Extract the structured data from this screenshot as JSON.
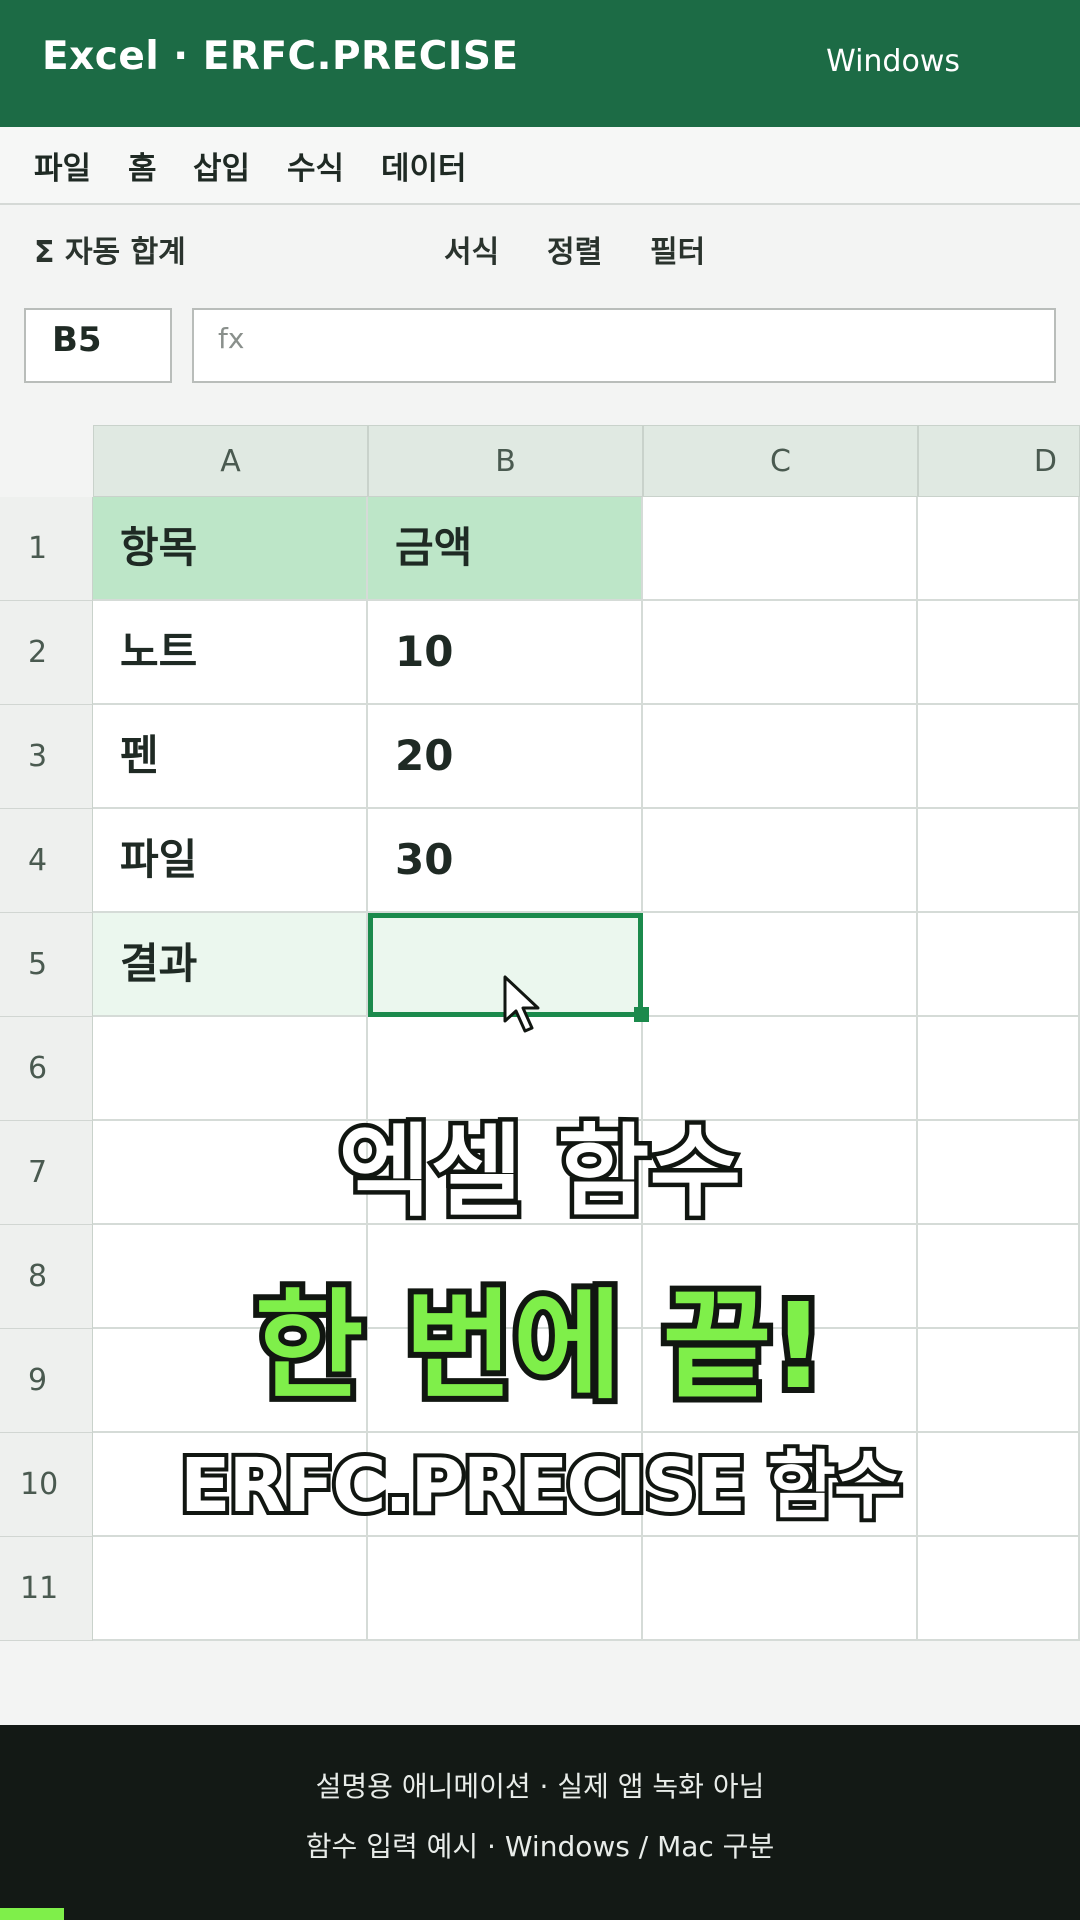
{
  "titlebar": {
    "title": "Excel · ERFC.PRECISE",
    "platform": "Windows"
  },
  "menu": {
    "items": [
      "파일",
      "홈",
      "삽입",
      "수식",
      "데이터"
    ]
  },
  "ribbon": {
    "autosum": "Σ 자동 합계",
    "format": "서식",
    "sort": "정렬",
    "filter": "필터"
  },
  "formula_bar": {
    "name_box": "B5",
    "fx_label": "fx",
    "value": ""
  },
  "sheet": {
    "columns": [
      "A",
      "B",
      "C",
      "D"
    ],
    "rows": [
      "1",
      "2",
      "3",
      "4",
      "5",
      "6",
      "7",
      "8",
      "9",
      "10",
      "11"
    ],
    "cells": {
      "a1": "항목",
      "b1": "금액",
      "a2": "노트",
      "b2": "10",
      "a3": "펜",
      "b3": "20",
      "a4": "파일",
      "b4": "30",
      "a5": "결과",
      "b5": ""
    },
    "selected_cell": "B5"
  },
  "overlay": {
    "line1": "엑셀 함수",
    "line2": "한 번에 끝!",
    "line3": "ERFC.PRECISE 함수"
  },
  "footer": {
    "note1": "설명용 애니메이션 · 실제 앱 녹화 아님",
    "note2": "함수 입력 예시 · Windows / Mac 구분"
  },
  "colors": {
    "brand": "#1c6b45",
    "selection": "#1b8a4c",
    "header_fill": "#bde6c8",
    "accent": "#7fef4a"
  }
}
